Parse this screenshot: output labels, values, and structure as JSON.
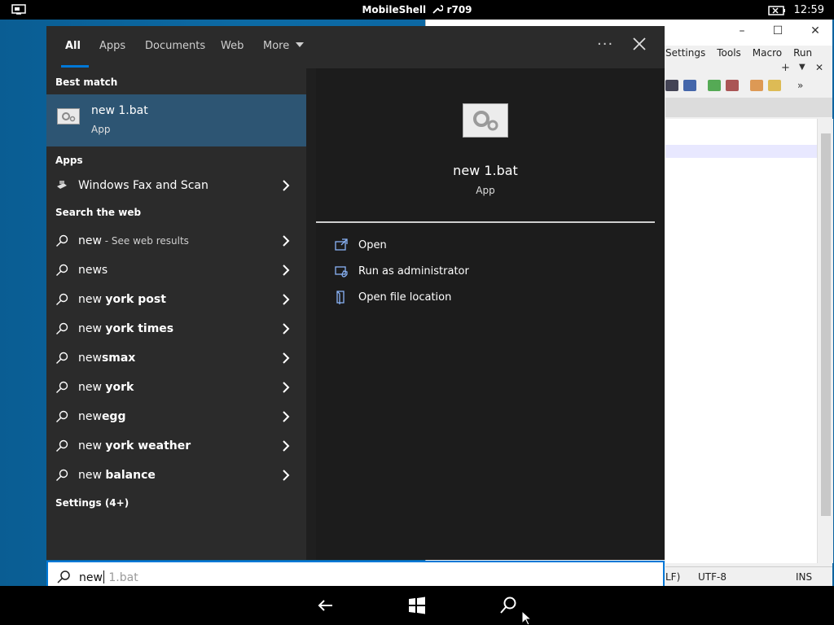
{
  "topbar": {
    "title": "MobileShell",
    "build": "r709",
    "time": "12:59"
  },
  "editor": {
    "menu": [
      "Settings",
      "Tools",
      "Macro",
      "Run"
    ],
    "status": {
      "eol": "LF)",
      "encoding": "UTF-8",
      "mode": "INS"
    }
  },
  "tabs": [
    {
      "label": "All",
      "active": true
    },
    {
      "label": "Apps",
      "active": false
    },
    {
      "label": "Documents",
      "active": false
    },
    {
      "label": "Web",
      "active": false
    },
    {
      "label": "More",
      "active": false
    }
  ],
  "more_dots": "···",
  "sections": {
    "best_match": "Best match",
    "apps": "Apps",
    "search_web": "Search the web",
    "settings": "Settings (4+)"
  },
  "best_match": {
    "title": "new 1.bat",
    "subtitle": "App"
  },
  "apps": [
    {
      "label": "Windows Fax and Scan"
    }
  ],
  "web_results": [
    {
      "prefix": "new",
      "bold": "",
      "suffix": " - See web results"
    },
    {
      "prefix": "news",
      "bold": "",
      "suffix": ""
    },
    {
      "prefix": "new ",
      "bold": "york post",
      "suffix": ""
    },
    {
      "prefix": "new ",
      "bold": "york times",
      "suffix": ""
    },
    {
      "prefix": "new",
      "bold": "smax",
      "suffix": ""
    },
    {
      "prefix": "new ",
      "bold": "york",
      "suffix": ""
    },
    {
      "prefix": "new",
      "bold": "egg",
      "suffix": ""
    },
    {
      "prefix": "new ",
      "bold": "york weather",
      "suffix": ""
    },
    {
      "prefix": "new ",
      "bold": "balance",
      "suffix": ""
    }
  ],
  "preview": {
    "title": "new 1.bat",
    "subtitle": "App",
    "actions": [
      {
        "label": "Open",
        "icon": "open-icon"
      },
      {
        "label": "Run as administrator",
        "icon": "shield-icon"
      },
      {
        "label": "Open file location",
        "icon": "folder-location-icon"
      }
    ]
  },
  "search": {
    "typed": "new",
    "suggestion": " 1.bat"
  },
  "colors": {
    "accent": "#0078d7",
    "selected": "#2d5573",
    "panel": "#2b2b2b",
    "desktop": "#0b63a0"
  }
}
